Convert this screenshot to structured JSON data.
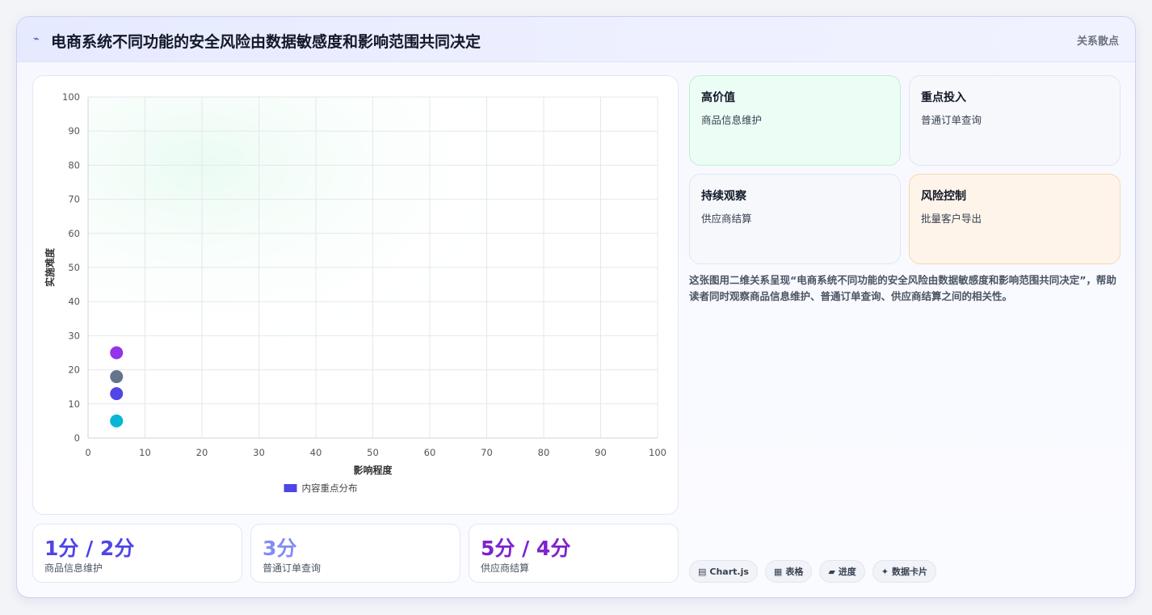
{
  "header": {
    "icon": "⌁",
    "title": "电商系统不同功能的安全风险由数据敏感度和影响范围共同决定",
    "tag": "关系散点"
  },
  "chart_data": {
    "type": "scatter",
    "xlabel": "影响程度",
    "ylabel": "实施难度",
    "xlim": [
      0,
      100
    ],
    "ylim": [
      0,
      100
    ],
    "xticks": [
      0,
      10,
      20,
      30,
      40,
      50,
      60,
      70,
      80,
      90,
      100
    ],
    "yticks": [
      0,
      10,
      20,
      30,
      40,
      50,
      60,
      70,
      80,
      90,
      100
    ],
    "grid": true,
    "legend": {
      "placement": "bottom",
      "label": "内容重点分布",
      "color": "#4f46e5"
    },
    "points": [
      {
        "x": 5,
        "y": 25,
        "color": "#9333ea"
      },
      {
        "x": 5,
        "y": 18,
        "color": "#64748b"
      },
      {
        "x": 5,
        "y": 13,
        "color": "#4f46e5"
      },
      {
        "x": 5,
        "y": 5,
        "color": "#06b6d4"
      }
    ]
  },
  "stats": [
    {
      "value": "1分 / 2分",
      "label": "商品信息维护",
      "color": "#4f46e5"
    },
    {
      "value": "3分",
      "label": "普通订单查询",
      "color": "#818cf8"
    },
    {
      "value": "5分 / 4分",
      "label": "供应商结算",
      "color": "#7e22ce"
    }
  ],
  "quadrants": [
    {
      "title": "高价值",
      "item": "商品信息维护",
      "bg": "#ecfdf5",
      "border": "#bbf0d5"
    },
    {
      "title": "重点投入",
      "item": "普通订单查询",
      "bg": "#f7f8fc",
      "border": "#e1e5f2"
    },
    {
      "title": "持续观察",
      "item": "供应商结算",
      "bg": "#f7f8fc",
      "border": "#e1e5f2"
    },
    {
      "title": "风险控制",
      "item": "批量客户导出",
      "bg": "#fff4ea",
      "border": "#f6d7b5"
    }
  ],
  "description": "这张图用二维关系呈现“电商系统不同功能的安全风险由数据敏感度和影响范围共同决定”，帮助读者同时观察商品信息维护、普通订单查询、供应商结算之间的相关性。",
  "chips": [
    {
      "icon": "▤",
      "label": "Chart.js"
    },
    {
      "icon": "▦",
      "label": "表格"
    },
    {
      "icon": "▰",
      "label": "进度"
    },
    {
      "icon": "✦",
      "label": "数据卡片"
    }
  ]
}
